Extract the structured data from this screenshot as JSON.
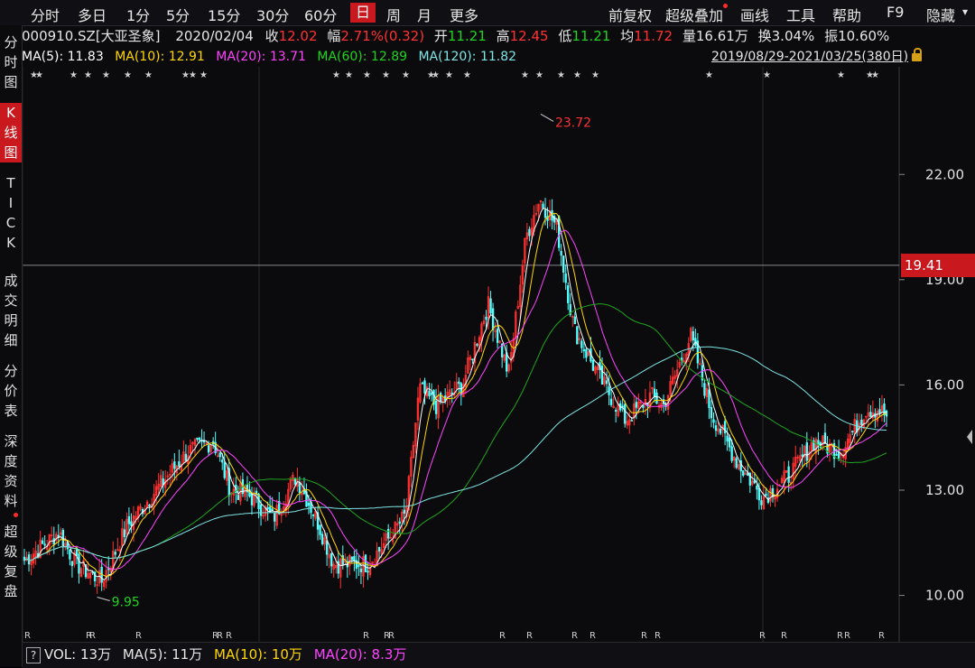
{
  "menubar": {
    "left_items": [
      "分时",
      "多日",
      "1分",
      "5分",
      "15分",
      "30分",
      "60分",
      "日",
      "周",
      "月",
      "更多"
    ],
    "active": "日",
    "right_items": [
      "前复权",
      "超级叠加",
      "画线",
      "工具",
      "帮助",
      "F9",
      "隐藏"
    ]
  },
  "info": {
    "code": "000910.SZ[大亚圣象]",
    "date": "2020/02/04",
    "close_label": "收",
    "close": "12.02",
    "change_label": "幅",
    "change": "2.71%(0.32)",
    "open_label": "开",
    "open": "11.21",
    "high_label": "高",
    "high": "12.45",
    "low_label": "低",
    "low": "11.21",
    "avg_label": "均",
    "avg": "11.72",
    "volume_label": "量",
    "volume": "16.61万",
    "turnover_label": "换",
    "turnover": "3.04%",
    "amplitude_label": "振",
    "amplitude": "10.60%"
  },
  "ma": {
    "ma5": "MA(5): 11.83",
    "ma10": "MA(10): 12.91",
    "ma20": "MA(20): 13.71",
    "ma60": "MA(60): 12.89",
    "ma120": "MA(120): 11.82",
    "range": "2019/08/29-2021/03/25(380日)"
  },
  "sidebar": [
    "分时图",
    "K线图",
    "TICK",
    "成交明细",
    "分价表",
    "深度资料",
    "超级复盘"
  ],
  "sidebar_active": "K线图",
  "volume": {
    "vol": "VOL: 13万",
    "ma5": "MA(5): 11万",
    "ma10": "MA(10): 10万",
    "ma20": "MA(20): 8.3万"
  },
  "price_tag": "19.41",
  "colors": {
    "up": "#ff3232",
    "down": "#54ffff",
    "ma5": "#ffffff",
    "ma10": "#ffd700",
    "ma20": "#ff44ff",
    "ma60": "#1fa51f",
    "ma120": "#7fe4e4",
    "active_bg": "#c9191e"
  },
  "chart_data": {
    "type": "candlestick",
    "yticks": [
      "22.00",
      "19.00",
      "16.00",
      "13.00",
      "10.00"
    ],
    "ytick_values": [
      22,
      19,
      16,
      13,
      10
    ],
    "max_label": "23.72",
    "min_label": "9.95",
    "max_value": 23.72,
    "min_value": 9.95,
    "crosshair_price": 19.41,
    "ylim": [
      9.5,
      24.4
    ],
    "num_bars": 380,
    "close_path": [
      [
        0,
        11.0
      ],
      [
        20,
        11.8
      ],
      [
        30,
        10.9
      ],
      [
        45,
        10.4
      ],
      [
        60,
        12.0
      ],
      [
        80,
        13.2
      ],
      [
        95,
        14.1
      ],
      [
        110,
        14.4
      ],
      [
        120,
        13.0
      ],
      [
        130,
        12.9
      ],
      [
        145,
        12.2
      ],
      [
        158,
        13.4
      ],
      [
        170,
        12.2
      ],
      [
        180,
        10.9
      ],
      [
        200,
        10.9
      ],
      [
        215,
        11.8
      ],
      [
        222,
        12.3
      ],
      [
        230,
        15.9
      ],
      [
        240,
        15.4
      ],
      [
        255,
        16.0
      ],
      [
        270,
        18.3
      ],
      [
        282,
        16.3
      ],
      [
        292,
        20.2
      ],
      [
        300,
        21.3
      ],
      [
        310,
        20.5
      ],
      [
        320,
        17.6
      ],
      [
        335,
        16.2
      ],
      [
        350,
        15.0
      ],
      [
        365,
        15.7
      ],
      [
        372,
        15.4
      ],
      [
        388,
        17.4
      ],
      [
        400,
        15.2
      ],
      [
        415,
        13.8
      ],
      [
        430,
        12.8
      ],
      [
        445,
        13.4
      ],
      [
        460,
        14.4
      ],
      [
        475,
        14.1
      ],
      [
        490,
        15.3
      ],
      [
        498,
        15.3
      ],
      [
        502,
        15.1
      ]
    ],
    "r_markers": [
      "R",
      "R",
      "R",
      "R",
      "R",
      "R",
      "R",
      "R",
      "R",
      "R",
      "R",
      "R",
      "R",
      "R",
      "R",
      "R",
      "R",
      "R",
      "R",
      "R",
      "R"
    ]
  }
}
